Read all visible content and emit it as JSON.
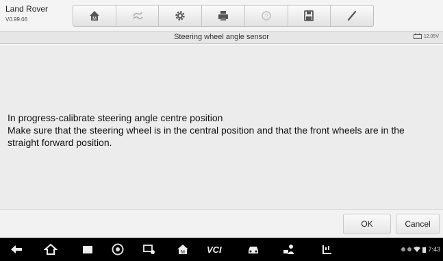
{
  "brand": {
    "name": "Land Rover",
    "version": "V0.99.06"
  },
  "toolbar": {
    "icons": [
      "home-icon",
      "vehicle-swap-icon",
      "settings-icon",
      "print-icon",
      "help-icon",
      "save-icon",
      "edit-icon"
    ]
  },
  "title_bar": {
    "title": "Steering wheel angle sensor",
    "battery_voltage": "12.05V"
  },
  "message": {
    "line1": "In progress-calibrate steering angle centre position",
    "line2": "Make sure that the steering wheel is in the central position and that the front wheels are in the straight forward position."
  },
  "buttons": {
    "ok": "OK",
    "cancel": "Cancel"
  },
  "navbar": {
    "icons": [
      "back-icon",
      "home-icon",
      "recent-apps-icon",
      "chrome-icon",
      "display-icon",
      "maxisys-home-icon",
      "vci-icon",
      "car-icon",
      "user-icon",
      "shop-icon"
    ],
    "vci_label": "VCI",
    "time": "7:43"
  },
  "colors": {
    "background": "#ececec",
    "navbar": "#000000",
    "toolbar": "#f4f4f4"
  }
}
